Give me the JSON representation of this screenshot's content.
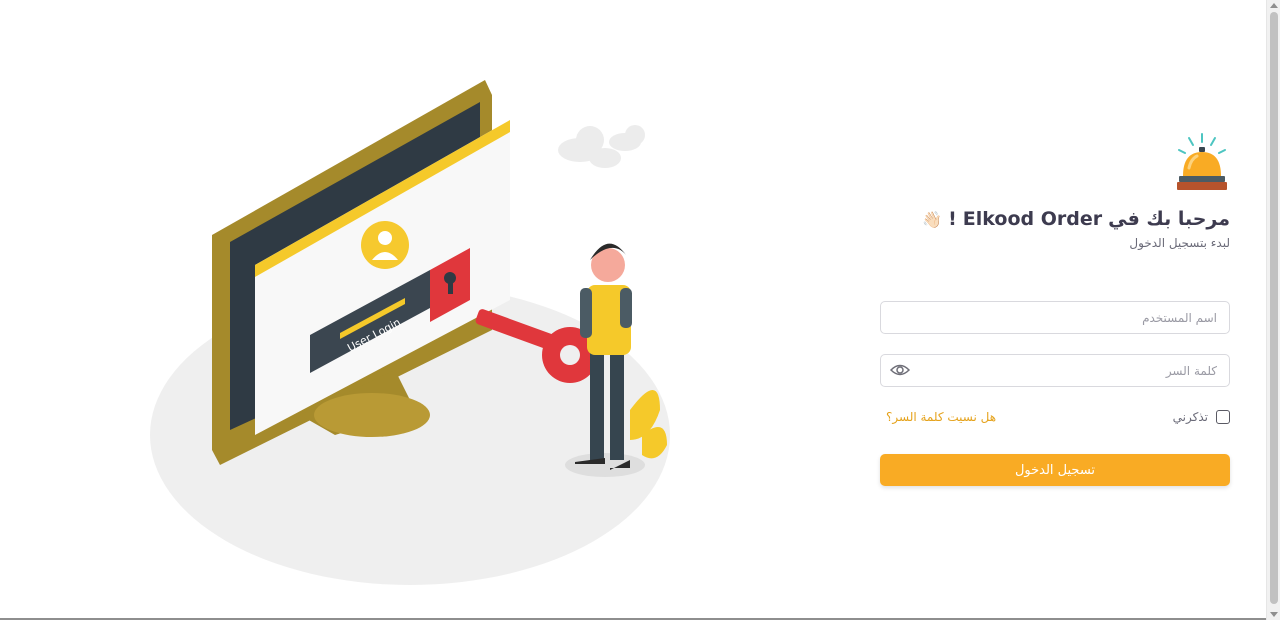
{
  "illustration": {
    "screen_text": "User Login"
  },
  "login": {
    "title_prefix": "مرحبا بك في",
    "title_brand": "Elkood Order",
    "title_suffix": "!",
    "wave_emoji": "👋🏻",
    "subtitle": "لبدء بتسجيل الدخول",
    "username_placeholder": "اسم المستخدم",
    "password_placeholder": "كلمة السر",
    "remember_label": "تذكرني",
    "forgot_link": "هل نسيت كلمة السر؟",
    "submit_label": "تسجيل الدخول"
  },
  "icons": {
    "logo": "service-bell-icon",
    "password_toggle": "eye-icon"
  },
  "colors": {
    "accent": "#f9ab24",
    "link": "#e5a21b",
    "monitor": "#b1912f",
    "key": "#e0373c"
  }
}
